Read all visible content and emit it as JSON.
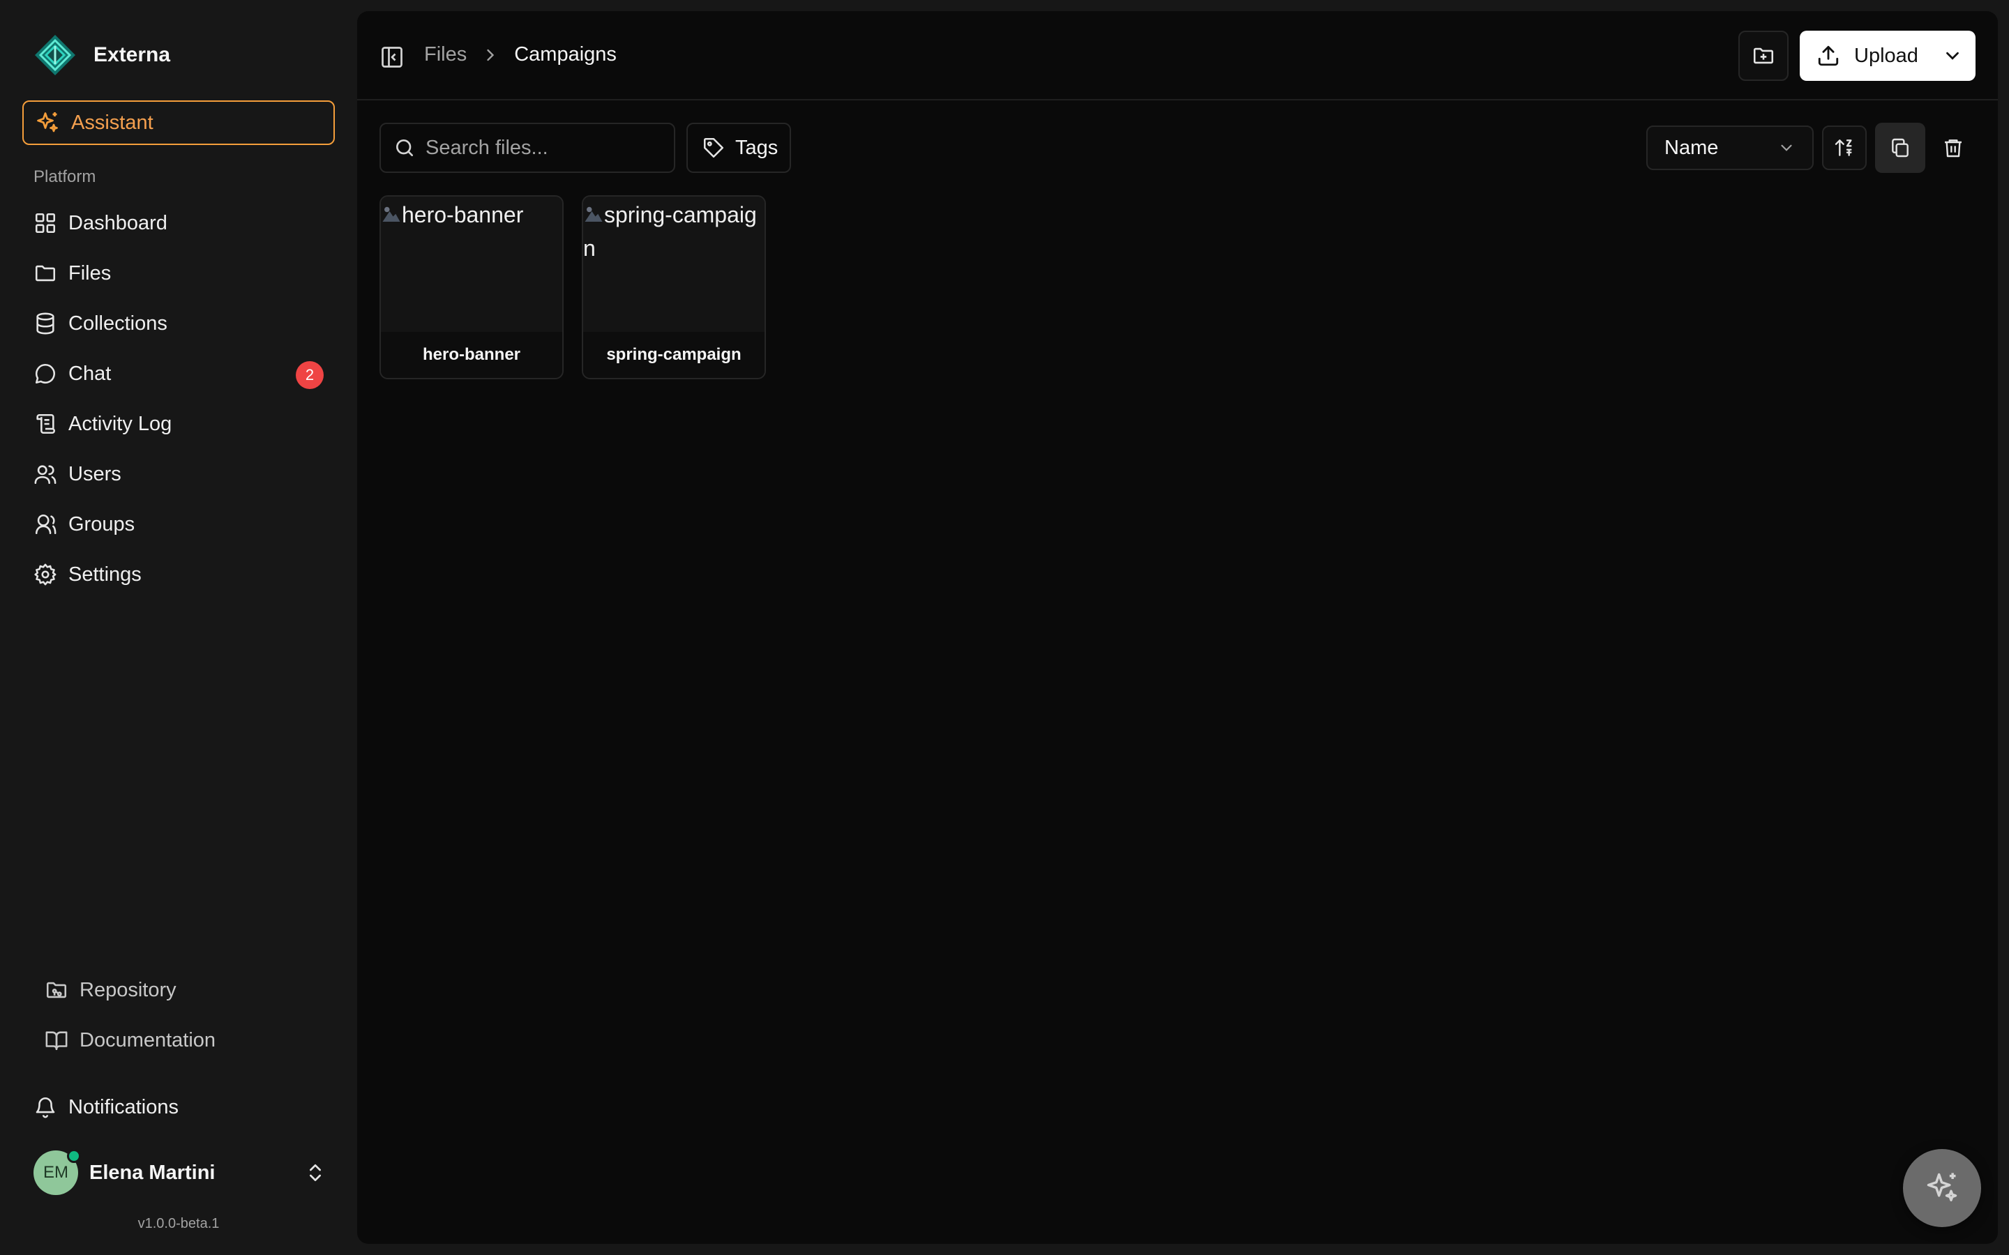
{
  "brand": {
    "name": "Externa"
  },
  "sidebar": {
    "assistant_label": "Assistant",
    "section_label": "Platform",
    "items": [
      {
        "label": "Dashboard",
        "icon": "grid-icon"
      },
      {
        "label": "Files",
        "icon": "folder-icon"
      },
      {
        "label": "Collections",
        "icon": "database-icon"
      },
      {
        "label": "Chat",
        "icon": "chat-bubble-icon",
        "badge": "2"
      },
      {
        "label": "Activity Log",
        "icon": "scroll-log-icon"
      },
      {
        "label": "Users",
        "icon": "users-icon"
      },
      {
        "label": "Groups",
        "icon": "user-group-icon"
      },
      {
        "label": "Settings",
        "icon": "gear-icon"
      }
    ],
    "bottom_links": [
      {
        "label": "Repository",
        "icon": "folder-git-icon"
      },
      {
        "label": "Documentation",
        "icon": "book-open-icon"
      }
    ],
    "notifications_label": "Notifications",
    "user": {
      "initials": "EM",
      "name": "Elena Martini"
    },
    "version": "v1.0.0-beta.1"
  },
  "header": {
    "breadcrumb": {
      "root": "Files",
      "current": "Campaigns"
    },
    "upload_label": "Upload"
  },
  "toolbar": {
    "search_placeholder": "Search files...",
    "tags_label": "Tags",
    "sort_selected": "Name"
  },
  "files": [
    {
      "alt": "hero-banner",
      "name": "hero-banner"
    },
    {
      "alt": "spring-campaign",
      "name": "spring-campaign"
    }
  ],
  "colors": {
    "accent": "#f59e3b",
    "badge": "#ef4444",
    "online": "#10b981",
    "sidebar_bg": "#171717",
    "main_bg": "#0a0a0a"
  }
}
